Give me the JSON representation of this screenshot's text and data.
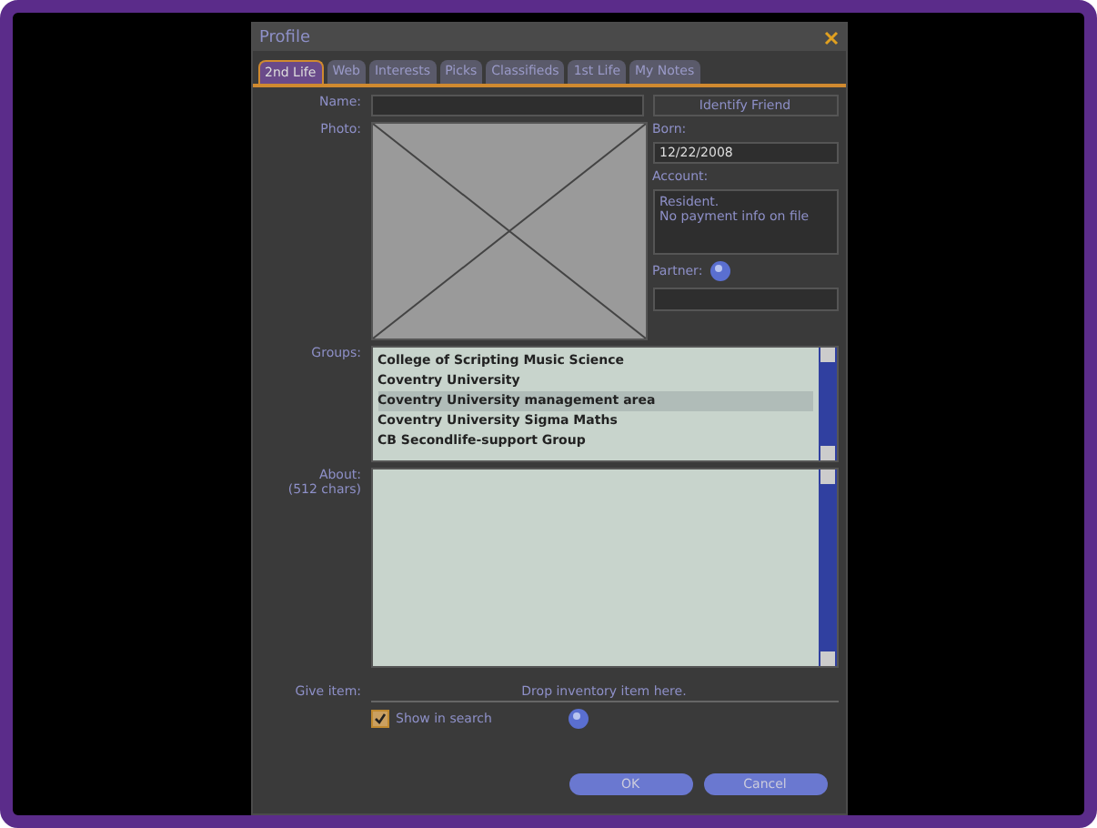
{
  "window": {
    "title": "Profile"
  },
  "tabs": [
    {
      "label": "2nd Life",
      "selected": true
    },
    {
      "label": "Web",
      "selected": false
    },
    {
      "label": "Interests",
      "selected": false
    },
    {
      "label": "Picks",
      "selected": false
    },
    {
      "label": "Classifieds",
      "selected": false
    },
    {
      "label": "1st Life",
      "selected": false
    },
    {
      "label": "My Notes",
      "selected": false
    }
  ],
  "name": {
    "label": "Name:"
  },
  "photo": {
    "label": "Photo:"
  },
  "identify_button": "Identify Friend",
  "born": {
    "label": "Born:",
    "value": "12/22/2008"
  },
  "account": {
    "label": "Account:",
    "value": "Resident.\nNo payment info on file"
  },
  "partner": {
    "label": "Partner:"
  },
  "groups": {
    "label": "Groups:",
    "items": [
      {
        "name": "College of Scripting Music Science",
        "selected": false
      },
      {
        "name": "Coventry University",
        "selected": false
      },
      {
        "name": "Coventry University management area",
        "selected": true
      },
      {
        "name": "Coventry University Sigma Maths",
        "selected": false
      },
      {
        "name": "CB Secondlife-support Group",
        "selected": false
      }
    ]
  },
  "about": {
    "label": "About:",
    "hint": "(512 chars)"
  },
  "give_item": {
    "label": "Give item:",
    "placeholder": "Drop inventory item here."
  },
  "show_in_search": {
    "label": "Show in search",
    "checked": true
  },
  "buttons": [
    "OK",
    "Cancel"
  ]
}
